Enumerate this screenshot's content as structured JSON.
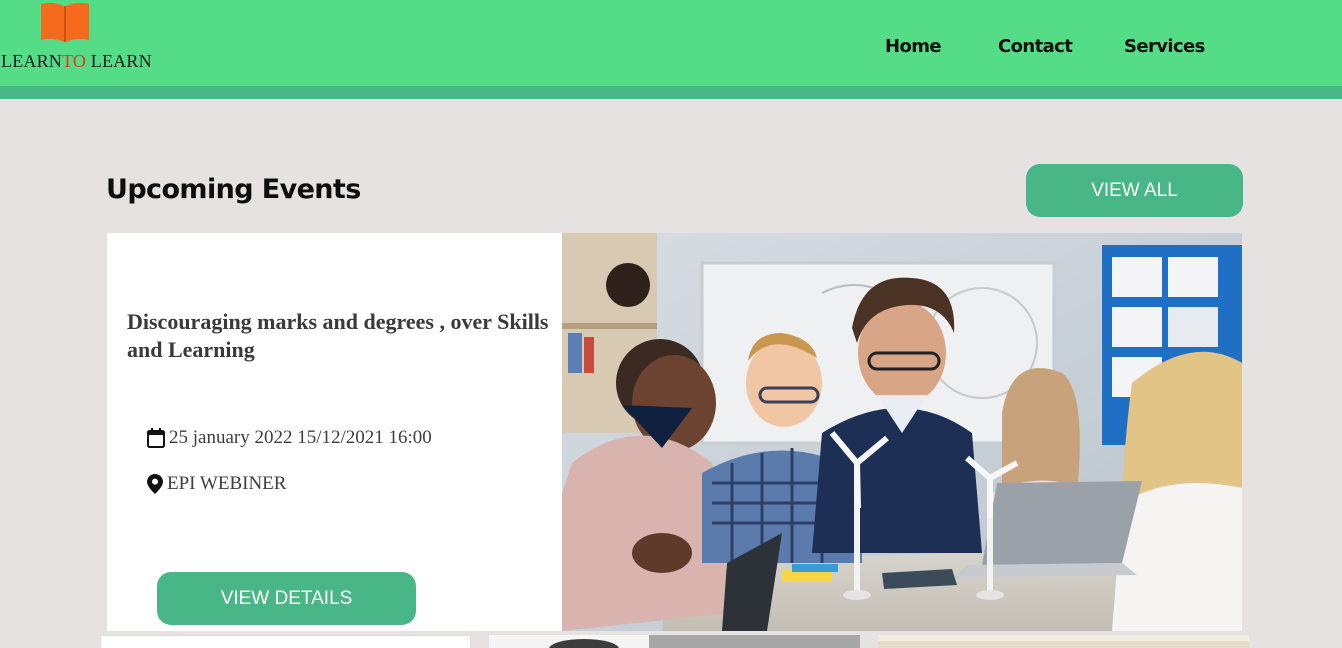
{
  "brand": {
    "logo_prefix": "LEARN",
    "logo_accent": "TO",
    "logo_suffix": " LEARN",
    "logo_icon": "open-book-icon",
    "colors": {
      "navbar": "#54dc87",
      "navbar_strip": "#47b888",
      "button": "#48b686",
      "logo_icon": "#f56a1d",
      "logo_accent": "#e4361c"
    }
  },
  "nav": {
    "home": "Home",
    "contact": "Contact",
    "services": "Services"
  },
  "events": {
    "section_title": "Upcoming Events",
    "view_all_label": "VIEW ALL",
    "featured": {
      "title": "Discouraging marks and degrees , over Skills and Learning",
      "date_text": "25 january 2022 15/12/2021 16:00",
      "date_icon": "calendar-icon",
      "location_text": "EPI WEBINER",
      "location_icon": "location-pin-icon",
      "image_desc_icon": "classroom-photo",
      "details_label": "VIEW DETAILS"
    }
  }
}
